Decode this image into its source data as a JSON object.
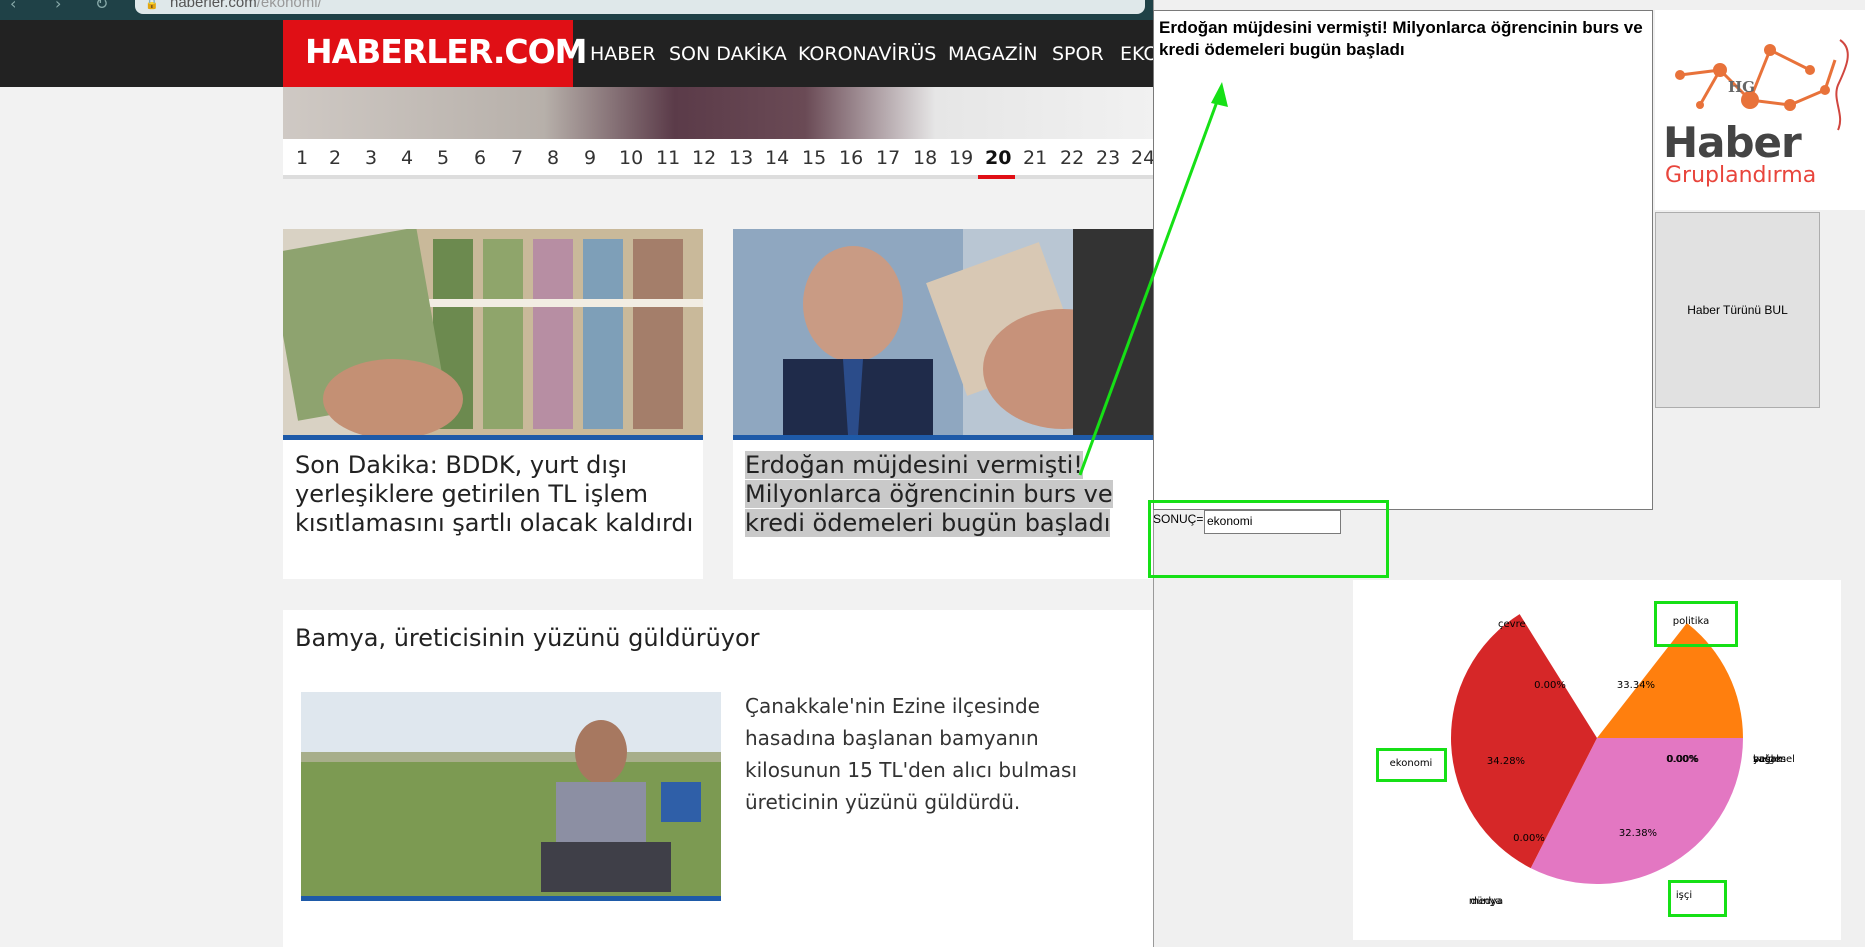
{
  "browser": {
    "url_domain": "haberler.com",
    "url_path": "/ekonomi/"
  },
  "site": {
    "logo": "HABERLER.COM",
    "nav": [
      "HABER",
      "SON DAKİKA",
      "KORONAVİRÜS",
      "MAGAZİN",
      "SPOR",
      "EKO"
    ],
    "pagination": [
      "1",
      "2",
      "3",
      "4",
      "5",
      "6",
      "7",
      "8",
      "9",
      "10",
      "11",
      "12",
      "13",
      "14",
      "15",
      "16",
      "17",
      "18",
      "19",
      "20",
      "21",
      "22",
      "23",
      "24"
    ],
    "active_page": "20"
  },
  "cards": [
    {
      "title": "Son Dakika: BDDK, yurt dışı yerleşiklere getirilen TL işlem kısıtlamasını şartlı olacak kaldırdı",
      "lines": [
        "Son Dakika: BDDK, yurt dışı",
        "yerleşiklere getirilen TL işlem",
        "kısıtlamasını şartlı olacak kaldırdı"
      ]
    },
    {
      "title": "Erdoğan müjdesini vermişti! Milyonlarca öğrencinin burs ve kredi ödemeleri bugün başladı",
      "lines": [
        "Erdoğan müjdesini vermişti!",
        "Milyonlarca öğrencinin burs ve",
        "kredi ödemeleri bugün başladı"
      ],
      "selected": true
    }
  ],
  "article": {
    "title": "Bamya, üreticisinin yüzünü güldürüyor",
    "body_lines": [
      "Çanakkale'nin Ezine ilçesinde",
      "hasadına başlanan bamyanın",
      "kilosunun 15 TL'den alıcı bulması",
      "üreticinin yüzünü güldürdü."
    ]
  },
  "app": {
    "news_text": "Erdoğan müjdesini vermişti! Milyonlarca öğrencinin burs ve kredi ödemeleri bugün başladı",
    "logo_main": "Haber",
    "logo_sub": "Gruplandırma",
    "logo_mark": "HG",
    "find_button": "Haber Türünü BUL",
    "result_label": "SONUÇ=",
    "result_value": "ekonomi"
  },
  "chart_data": {
    "type": "pie",
    "categories": [
      "politika",
      "çevre",
      "ekonomi",
      "dünya",
      "medya",
      "işçi",
      "sağlık",
      "yaşam",
      "belgesel"
    ],
    "values": [
      33.34,
      0.0,
      34.28,
      0.0,
      0.0,
      32.38,
      0.0,
      0.0,
      0.0
    ],
    "value_labels": [
      "33.34%",
      "0.00%",
      "34.28%",
      "0.00%",
      "32.38%",
      "0.00%",
      "0.00%"
    ],
    "colors": {
      "politika": "#ff7f0e",
      "ekonomi": "#d62728",
      "işçi": "#e377c2"
    }
  },
  "colors": {
    "brand_red": "#e00f15",
    "highlight_green": "#16e016",
    "nav_bg": "#222222"
  }
}
